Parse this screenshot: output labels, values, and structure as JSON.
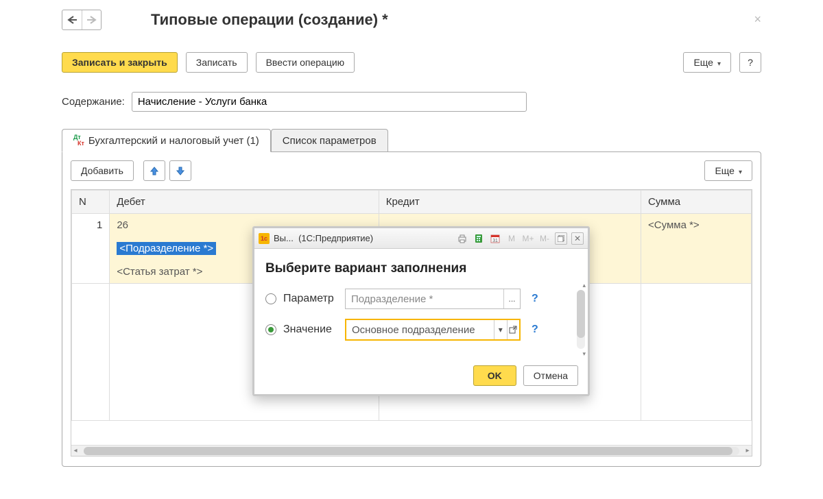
{
  "page": {
    "title": "Типовые операции (создание) *"
  },
  "toolbar": {
    "save_close": "Записать и закрыть",
    "save": "Записать",
    "enter_op": "Ввести операцию",
    "more": "Еще",
    "help": "?"
  },
  "content": {
    "label": "Содержание:",
    "value": "Начисление - Услуги банка"
  },
  "tabs": {
    "accounting": "Бухгалтерский и налоговый учет (1)",
    "params": "Список параметров"
  },
  "subtoolbar": {
    "add": "Добавить",
    "more": "Еще"
  },
  "grid": {
    "headers": {
      "n": "N",
      "debit": "Дебет",
      "credit": "Кредит",
      "sum": "Сумма"
    },
    "row1": {
      "n": "1",
      "account": "26",
      "subdivision": "<Подразделение *>",
      "cost_item": "<Статья затрат *>",
      "sum": "<Сумма *>"
    }
  },
  "modal": {
    "titlebar": {
      "app_short": "Вы...",
      "suffix": "(1С:Предприятие)",
      "m": "M",
      "mplus": "M+",
      "mminus": "M-"
    },
    "heading": "Выберите вариант заполнения",
    "opt_param": "Параметр",
    "opt_value": "Значение",
    "param_placeholder": "Подразделение *",
    "value_text": "Основное подразделение",
    "ok": "OK",
    "cancel": "Отмена",
    "dots": "...",
    "help": "?"
  }
}
